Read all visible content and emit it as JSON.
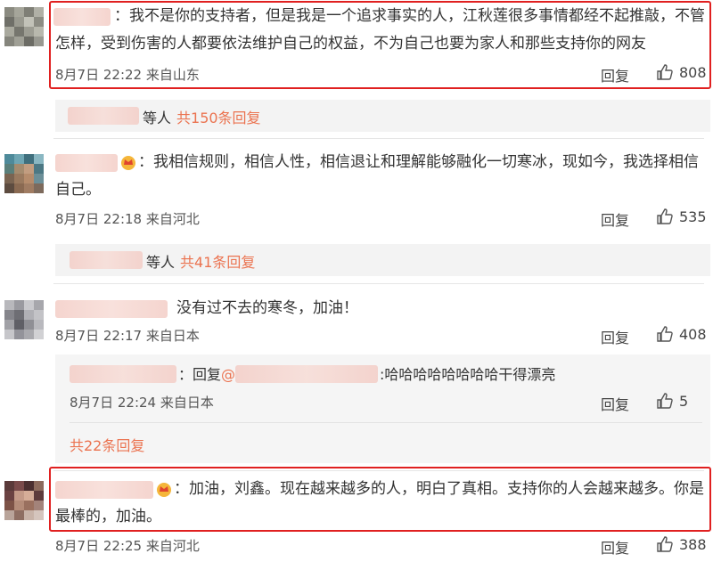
{
  "comments": [
    {
      "text_line1": "：我不是你的支持者，但是我是一个追求事实的人，江秋莲很多事情都经不起推敲，不管",
      "text_line2": "怎样，受到伤害的人都要依法维护自己的权益，不为自己也要为家人和那些支持你的网友",
      "meta": "8月7日 22:22 来自山东",
      "reply_label": "回复",
      "likes": "808",
      "replies_suffix": "等人",
      "replies_count": "共150条回复"
    },
    {
      "text_line1": "：我相信规则，相信人性，相信退让和理解能够融化一切寒冰，现如今，我选择相信",
      "text_line2": "自己。",
      "meta": "8月7日 22:18 来自河北",
      "reply_label": "回复",
      "likes": "535",
      "replies_suffix": "等人",
      "replies_count": "共41条回复"
    },
    {
      "text_line1": "没有过不去的寒冬，加油！",
      "meta": "8月7日 22:17 来自日本",
      "reply_label": "回复",
      "likes": "408",
      "sub_reply": {
        "prefix": "：回复",
        "at": "@",
        "text": ":哈哈哈哈哈哈哈哈干得漂亮",
        "meta": "8月7日 22:24 来自日本",
        "reply_label": "回复",
        "likes": "5"
      },
      "replies_count": "共22条回复"
    },
    {
      "text_line1": "：加油，刘鑫。现在越来越多的人，明白了真相。支持你的人会越来越多。你是",
      "text_line2": "最棒的，加油。",
      "meta": "8月7日 22:25 来自河北",
      "reply_label": "回复",
      "likes": "388"
    }
  ],
  "colors": {
    "highlight_box": "#e02020",
    "reply_count": "#eb7350"
  }
}
